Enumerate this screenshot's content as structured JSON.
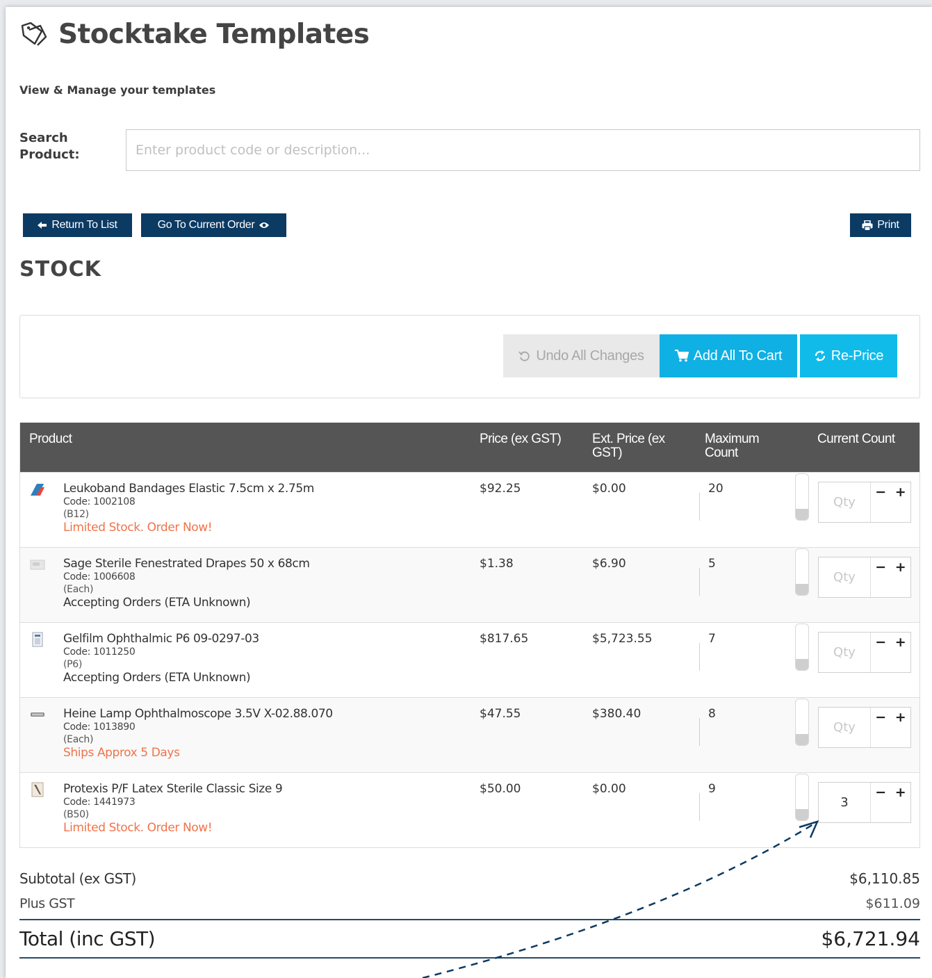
{
  "page": {
    "title": "Stocktake Templates",
    "subtitle": "View & Manage your templates",
    "title_icon": "tag-outline-icon"
  },
  "search": {
    "label": "Search Product:",
    "placeholder": "Enter product code or description...",
    "value": ""
  },
  "toolbar": {
    "return_label": "Return To List",
    "current_order_label": "Go To Current Order",
    "print_label": "Print"
  },
  "section": {
    "title": "STOCK"
  },
  "actions": {
    "undo_label": "Undo All Changes",
    "add_all_label": "Add All To Cart",
    "reprice_label": "Re-Price"
  },
  "table": {
    "headers": {
      "product": "Product",
      "price": "Price (ex GST)",
      "ext_price": "Ext. Price (ex GST)",
      "max_count": "Maximum Count",
      "current_count": "Current Count"
    },
    "qty_placeholder": "Qty",
    "rows": [
      {
        "name": "Leukoband Bandages Elastic 7.5cm x 2.75m",
        "code": "Code: 1002108",
        "unit": "(B12)",
        "status": "Limited Stock. Order Now!",
        "status_color": "#f0734a",
        "price": "$92.25",
        "ext_price": "$0.00",
        "max": "20",
        "qty": "",
        "thumb_icon": "bandage-product-icon"
      },
      {
        "name": "Sage Sterile Fenestrated Drapes 50 x 68cm",
        "code": "Code: 1006608",
        "unit": "(Each)",
        "status": "Accepting Orders (ETA Unknown)",
        "status_color": "#333333",
        "price": "$1.38",
        "ext_price": "$6.90",
        "max": "5",
        "qty": "",
        "thumb_icon": "drape-product-icon"
      },
      {
        "name": "Gelfilm Ophthalmic P6 09-0297-03",
        "code": "Code: 1011250",
        "unit": "(P6)",
        "status": "Accepting Orders (ETA Unknown)",
        "status_color": "#333333",
        "price": "$817.65",
        "ext_price": "$5,723.55",
        "max": "7",
        "qty": "",
        "thumb_icon": "box-product-icon"
      },
      {
        "name": "Heine Lamp Ophthalmoscope 3.5V X-02.88.070",
        "code": "Code: 1013890",
        "unit": "(Each)",
        "status": "Ships Approx 5 Days",
        "status_color": "#f0734a",
        "price": "$47.55",
        "ext_price": "$380.40",
        "max": "8",
        "qty": "",
        "thumb_icon": "lamp-product-icon"
      },
      {
        "name": "Protexis P/F Latex Sterile Classic Size 9",
        "code": "Code: 1441973",
        "unit": "(B50)",
        "status": "Limited Stock. Order Now!",
        "status_color": "#f0734a",
        "price": "$50.00",
        "ext_price": "$0.00",
        "max": "9",
        "qty": "3",
        "thumb_icon": "glove-box-product-icon"
      }
    ]
  },
  "totals": {
    "subtotal_label": "Subtotal (ex GST)",
    "subtotal_value": "$6,110.85",
    "gst_label": "Plus GST",
    "gst_value": "$611.09",
    "total_label": "Total (inc GST)",
    "total_value": "$6,721.94"
  },
  "colors": {
    "dark_button": "#0b3a63",
    "accent_cyan": "#0fb0e4",
    "table_header": "#555555",
    "warning_text": "#f0734a"
  }
}
